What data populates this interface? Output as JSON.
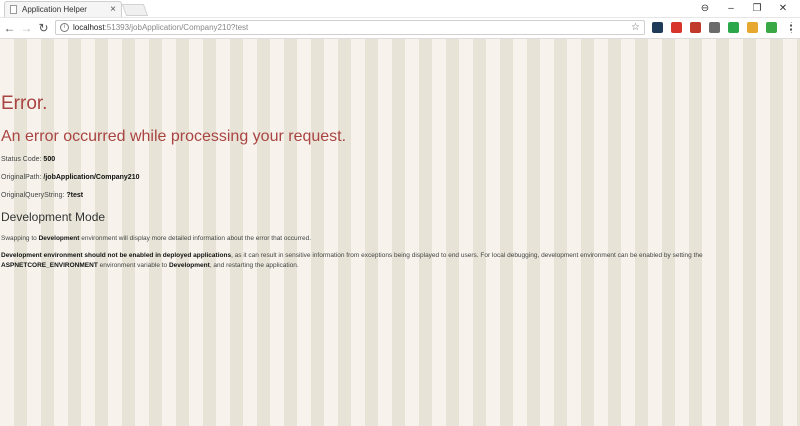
{
  "browser": {
    "tab_title": "Application Helper",
    "tab_close": "×",
    "window_controls": {
      "account": "⊖",
      "minimize": "–",
      "maximize": "❐",
      "close": "✕"
    },
    "url_host": "localhost",
    "url_path": ":51393/jobApplication/Company210?test",
    "nav": {
      "back": "←",
      "forward": "→",
      "reload": "↻"
    },
    "star": "☆",
    "extensions": [
      {
        "name": "ext-1-icon",
        "color": "#1f3b5a"
      },
      {
        "name": "ext-2-icon",
        "color": "#d9342b"
      },
      {
        "name": "ext-3-icon",
        "color": "#c0392b"
      },
      {
        "name": "ext-4-icon",
        "color": "#6b6b6b"
      },
      {
        "name": "ext-5-icon",
        "color": "#2aa84a"
      },
      {
        "name": "ext-6-icon",
        "color": "#e6a82e"
      },
      {
        "name": "ext-7-icon",
        "color": "#3aa845"
      },
      {
        "name": "menu-icon",
        "color": "#555555"
      }
    ]
  },
  "page": {
    "title": "Error.",
    "subtitle": "An error occurred while processing your request.",
    "status": {
      "label": "Status Code:",
      "value": "500"
    },
    "original_path": {
      "label": "OriginalPath:",
      "value": "/jobApplication/Company210"
    },
    "original_query": {
      "label": "OriginalQueryString:",
      "value": "?test"
    },
    "dev_heading": "Development Mode",
    "swap": {
      "pre": "Swapping to ",
      "bold": "Development",
      "post": " environment will display more detailed information about the error that occurred."
    },
    "warning": {
      "bold1": "Development environment should not be enabled in deployed applications",
      "text1": ", as it can result in sensitive information from exceptions being displayed to end users. For local debugging, development environment can be enabled by setting the ",
      "bold2": "ASPNETCORE_ENVIRONMENT",
      "text2": " environment variable to ",
      "bold3": "Development",
      "text3": ", and restarting the application."
    },
    "colors": {
      "error_red": "#a94442",
      "stripe_light": "#f7f3ec",
      "stripe_dark": "#e7e3d6"
    }
  }
}
